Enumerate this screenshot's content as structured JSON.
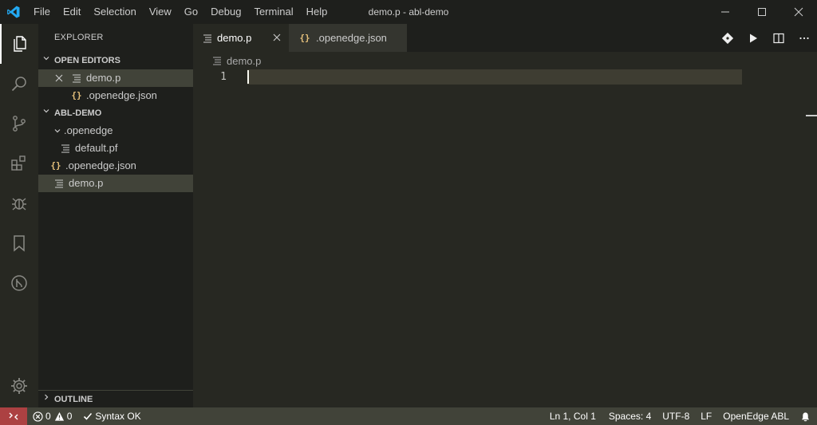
{
  "menu": [
    "File",
    "Edit",
    "Selection",
    "View",
    "Go",
    "Debug",
    "Terminal",
    "Help"
  ],
  "window_title": "demo.p - abl-demo",
  "sidebar": {
    "title": "EXPLORER",
    "open_editors_header": "OPEN EDITORS",
    "open_editors": [
      {
        "label": "demo.p",
        "icon": "lines-file-icon"
      },
      {
        "label": ".openedge.json",
        "icon": "json-icon"
      }
    ],
    "project_header": "ABL-DEMO",
    "tree": [
      {
        "label": ".openedge",
        "type": "folder"
      },
      {
        "label": "default.pf",
        "type": "file"
      },
      {
        "label": ".openedge.json",
        "type": "json"
      },
      {
        "label": "demo.p",
        "type": "file"
      }
    ],
    "outline_header": "OUTLINE"
  },
  "tabs": [
    {
      "label": "demo.p",
      "active": true
    },
    {
      "label": ".openedge.json",
      "active": false
    }
  ],
  "breadcrumb": "demo.p",
  "editor": {
    "line_numbers": [
      "1"
    ],
    "lines": [
      ""
    ]
  },
  "json_icon_glyph": "{}",
  "statusbar": {
    "errors": "0",
    "warnings": "0",
    "syntax": "Syntax OK",
    "position": "Ln 1, Col 1",
    "spaces": "Spaces: 4",
    "encoding": "UTF-8",
    "eol": "LF",
    "language": "OpenEdge ABL"
  },
  "colors": {
    "remote_badge": "#ac4142",
    "statusbar": "#414339",
    "accent_logo": "#23a9f2",
    "json_icon": "#e5c07b"
  }
}
